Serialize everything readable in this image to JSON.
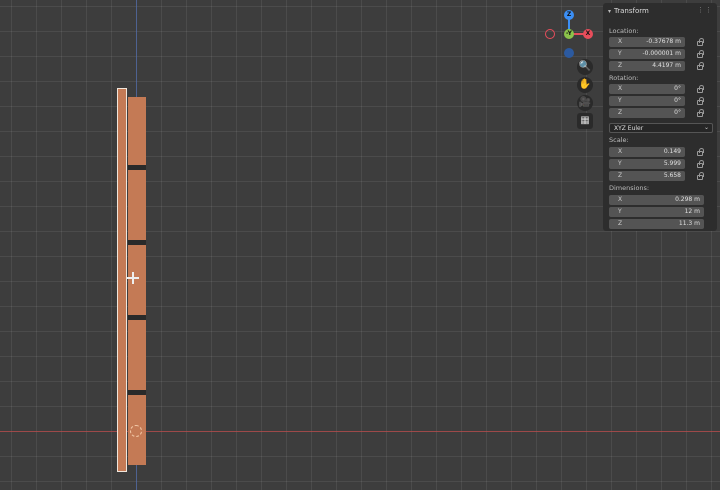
{
  "gizmo": {
    "z_label": "Z",
    "y_label": "-Y",
    "x_label": "X",
    "colors": {
      "x": "#e84d5b",
      "y": "#8bc34a",
      "z": "#3b8ff6",
      "negative": "#2c5aa0"
    }
  },
  "nav_tools": [
    {
      "name": "zoom-icon",
      "glyph": "🔍"
    },
    {
      "name": "hand-icon",
      "glyph": "✋"
    },
    {
      "name": "camera-icon",
      "glyph": "🎥"
    },
    {
      "name": "grid-icon",
      "glyph": "▦"
    }
  ],
  "transform": {
    "title": "Transform",
    "location": {
      "label": "Location:",
      "x": "-0.37678 m",
      "y": "-0.000001 m",
      "z": "4.4197 m"
    },
    "rotation": {
      "label": "Rotation:",
      "x": "0°",
      "y": "0°",
      "z": "0°"
    },
    "rotation_mode": "XYZ Euler",
    "scale": {
      "label": "Scale:",
      "x": "0.149",
      "y": "5.999",
      "z": "5.658"
    },
    "dimensions": {
      "label": "Dimensions:",
      "x": "0.298 m",
      "y": "12 m",
      "z": "11.3 m"
    },
    "axis_labels": {
      "x": "X",
      "y": "Y",
      "z": "Z"
    }
  },
  "colors": {
    "viewport_bg": "#3d3d3d",
    "object": "#c47a55",
    "x_axis": "#b84848",
    "y_axis": "#4f6aa8"
  }
}
